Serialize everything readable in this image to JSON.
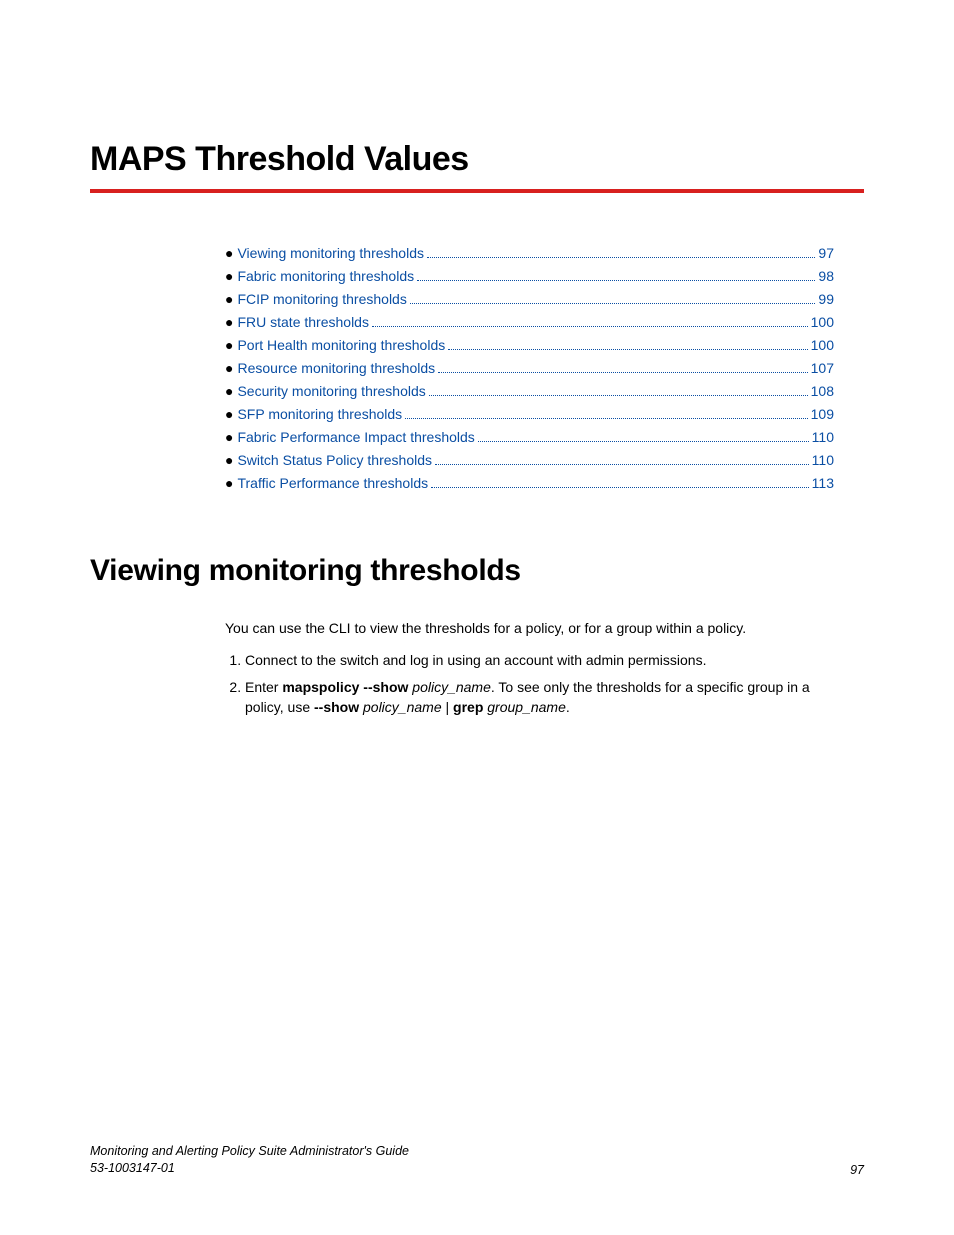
{
  "chapter_title": "MAPS Threshold Values",
  "toc": [
    {
      "label": "Viewing monitoring thresholds",
      "page": "97"
    },
    {
      "label": "Fabric monitoring thresholds",
      "page": "98"
    },
    {
      "label": "FCIP monitoring thresholds",
      "page": "99"
    },
    {
      "label": "FRU state thresholds",
      "page": "100"
    },
    {
      "label": "Port Health monitoring thresholds",
      "page": "100"
    },
    {
      "label": "Resource monitoring thresholds",
      "page": "107"
    },
    {
      "label": "Security monitoring thresholds",
      "page": "108"
    },
    {
      "label": "SFP monitoring thresholds",
      "page": "109"
    },
    {
      "label": "Fabric Performance Impact thresholds",
      "page": "110"
    },
    {
      "label": "Switch Status Policy thresholds",
      "page": "110"
    },
    {
      "label": "Traffic Performance thresholds",
      "page": "113"
    }
  ],
  "section_title": "Viewing monitoring thresholds",
  "intro": "You can use the CLI to view the thresholds for a policy, or for a group within a policy.",
  "steps": {
    "s1": "Connect to the switch and log in using an account with admin permissions.",
    "s2_prefix": "Enter ",
    "s2_cmd1": "mapspolicy --show",
    "s2_arg1": "policy_name",
    "s2_mid": ". To see only the thresholds for a specific group in a policy, use ",
    "s2_cmd2": "--show",
    "s2_arg2": "policy_name",
    "s2_pipe": " | ",
    "s2_cmd3": "grep",
    "s2_arg3": "group_name",
    "s2_end": "."
  },
  "footer": {
    "doc_title": "Monitoring and Alerting Policy Suite Administrator's Guide",
    "doc_number": "53-1003147-01",
    "page_number": "97"
  }
}
